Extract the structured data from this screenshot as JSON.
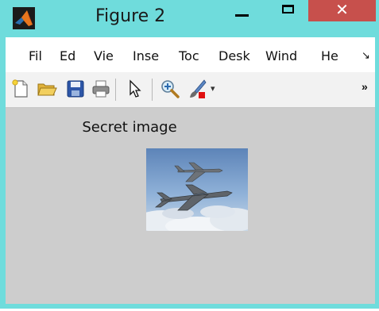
{
  "window": {
    "title": "Figure 2",
    "close_label": "✕",
    "controls": {
      "minimize": "minimize",
      "maximize": "maximize",
      "close": "close"
    }
  },
  "menubar": {
    "items": [
      "Fil",
      "Ed",
      "Vie",
      "Inse",
      "Toc",
      "Desk",
      "Wind",
      "He"
    ],
    "overflow": "↘"
  },
  "toolbar": {
    "icons": [
      "new-figure-icon",
      "open-file-icon",
      "save-icon",
      "print-icon",
      "pointer-icon",
      "zoom-in-icon",
      "brush-icon",
      "dropdown-arrow-icon"
    ],
    "dropdown_arrow": "▾",
    "overflow": "»"
  },
  "figure": {
    "title": "Secret image",
    "image_content": "two grey fighter jets flying over clouds, blue sky"
  },
  "colors": {
    "window_frame": "#6fdcdc",
    "close_button": "#c7504c",
    "figure_background": "#cdcdcd",
    "toolbar_background": "#f2f2f2"
  }
}
